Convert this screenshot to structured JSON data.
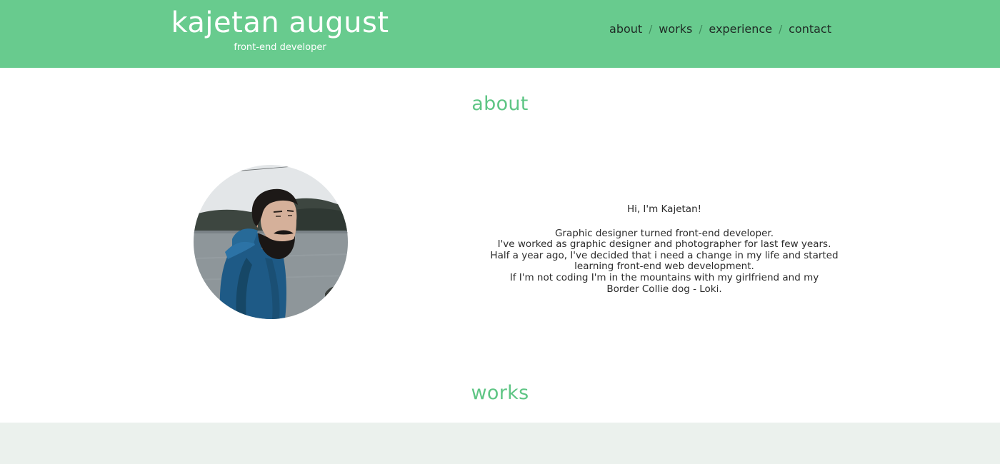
{
  "header": {
    "brand_name": "kajetan august",
    "brand_subtitle": "front-end developer",
    "background_color": "#68cb8e"
  },
  "nav": {
    "items": [
      {
        "label": "about"
      },
      {
        "label": "works"
      },
      {
        "label": "experience"
      },
      {
        "label": "contact"
      }
    ],
    "separator": "/"
  },
  "about": {
    "title": "about",
    "greeting": "Hi, I'm Kajetan!",
    "bio_lines": [
      "Graphic designer turned front-end developer.",
      "I've worked as graphic designer and photographer for last few years.",
      "Half a year ago, I've decided that i need a change in my life and started",
      "learning front-end web development.",
      "If I'm not coding I'm in the mountains with my girlfriend and my",
      "Border Collie dog - Loki."
    ]
  },
  "works": {
    "title": "works"
  },
  "colors": {
    "accent": "#5ec584",
    "works_band": "#ebf1ed"
  }
}
